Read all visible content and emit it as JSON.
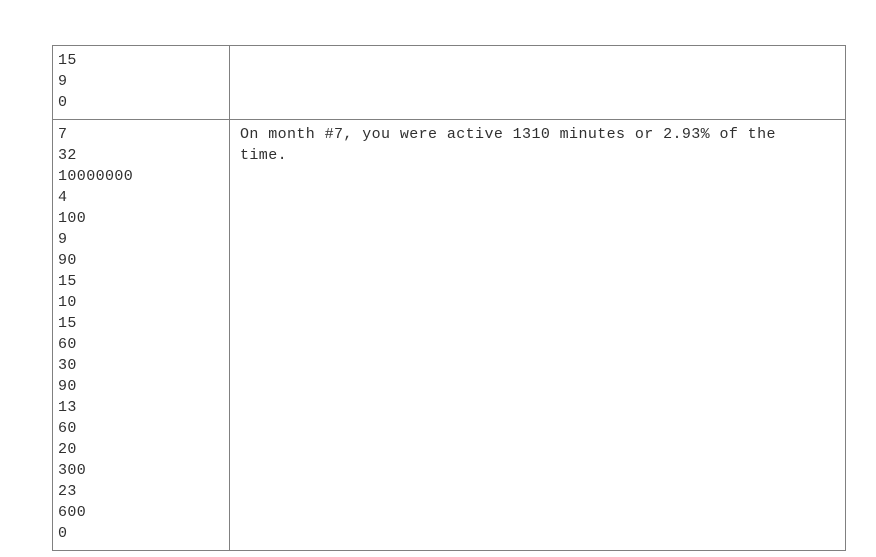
{
  "table": {
    "rows": [
      {
        "id": "row-top",
        "values": [
          "15",
          "9",
          "0"
        ],
        "message": ""
      },
      {
        "id": "row-main",
        "values": [
          "7",
          "32",
          "10000000",
          "4",
          "100",
          "9",
          "90",
          "15",
          "10",
          "15",
          "60",
          "30",
          "90",
          "13",
          "60",
          "20",
          "300",
          "23",
          "600",
          "0"
        ],
        "message": "On month #7, you were active 1310 minutes or 2.93% of the time."
      }
    ],
    "border_color": "#808080",
    "text_color": "#303030",
    "background_color": "#ffffff"
  },
  "message_details": {
    "month_number": "7",
    "active_minutes": "1310",
    "active_percent": "2.93%"
  }
}
